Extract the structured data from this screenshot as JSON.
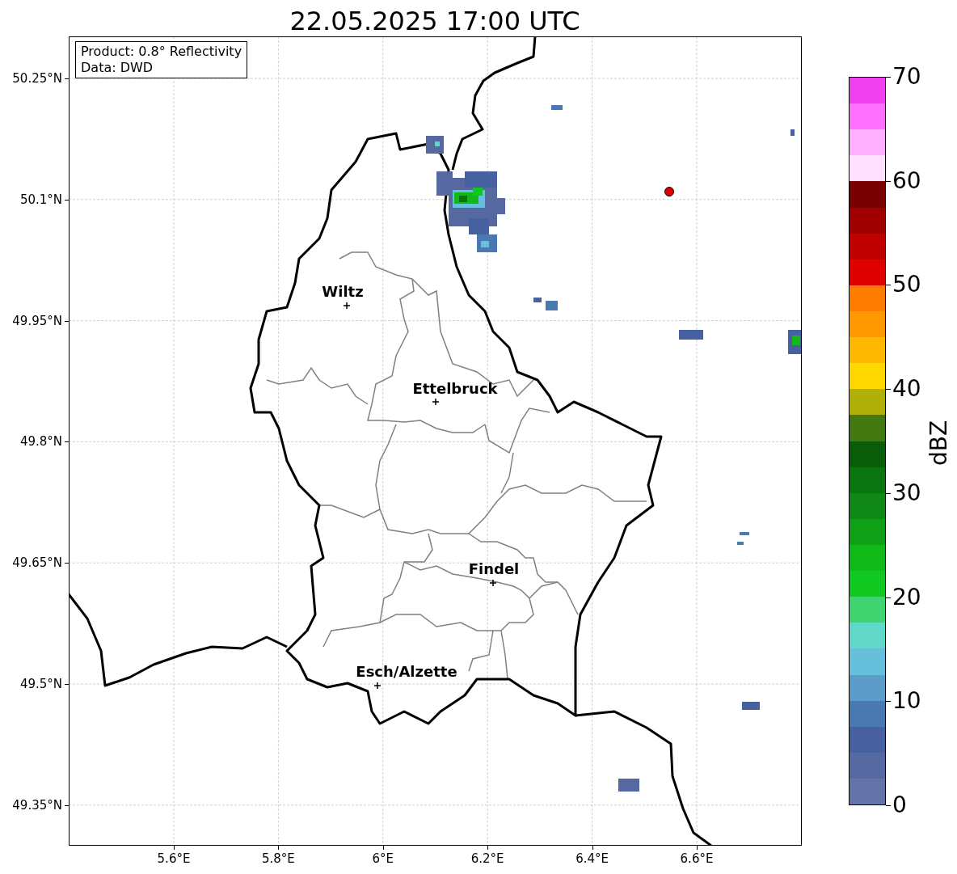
{
  "title": "22.05.2025 17:00 UTC",
  "info_box": [
    "Product: 0.8° Reflectivity",
    "Data: DWD"
  ],
  "map": {
    "yticks": [
      "50.25°N",
      "50.1°N",
      "49.95°N",
      "49.8°N",
      "49.65°N",
      "49.5°N",
      "49.35°N"
    ],
    "xticks": [
      "5.6°E",
      "5.8°E",
      "6°E",
      "6.2°E",
      "6.4°E",
      "6.6°E"
    ],
    "cities": [
      {
        "name": "Wiltz"
      },
      {
        "name": "Ettelbruck"
      },
      {
        "name": "Findel"
      },
      {
        "name": "Esch/Alzette"
      }
    ]
  },
  "colorbar": {
    "label": "dBZ",
    "ticks": [
      "70",
      "60",
      "50",
      "40",
      "30",
      "20",
      "10",
      "0"
    ],
    "segments": [
      {
        "color": "#f040f0"
      },
      {
        "color": "#ff70ff"
      },
      {
        "color": "#ffb0ff"
      },
      {
        "color": "#ffe0ff"
      },
      {
        "color": "#780000"
      },
      {
        "color": "#a00000"
      },
      {
        "color": "#c00000"
      },
      {
        "color": "#e00000"
      },
      {
        "color": "#ff7c00"
      },
      {
        "color": "#ff9800"
      },
      {
        "color": "#ffb800"
      },
      {
        "color": "#ffd800"
      },
      {
        "color": "#b0b008"
      },
      {
        "color": "#447810"
      },
      {
        "color": "#085c0a"
      },
      {
        "color": "#0a7410"
      },
      {
        "color": "#108818"
      },
      {
        "color": "#10a018"
      },
      {
        "color": "#10b818"
      },
      {
        "color": "#10c820"
      },
      {
        "color": "#40d470"
      },
      {
        "color": "#62d8c8"
      },
      {
        "color": "#66c0dc"
      },
      {
        "color": "#5b9cc8"
      },
      {
        "color": "#4a78b0"
      },
      {
        "color": "#4660a0"
      },
      {
        "color": "#5568a0"
      },
      {
        "color": "#6474a8"
      }
    ]
  }
}
